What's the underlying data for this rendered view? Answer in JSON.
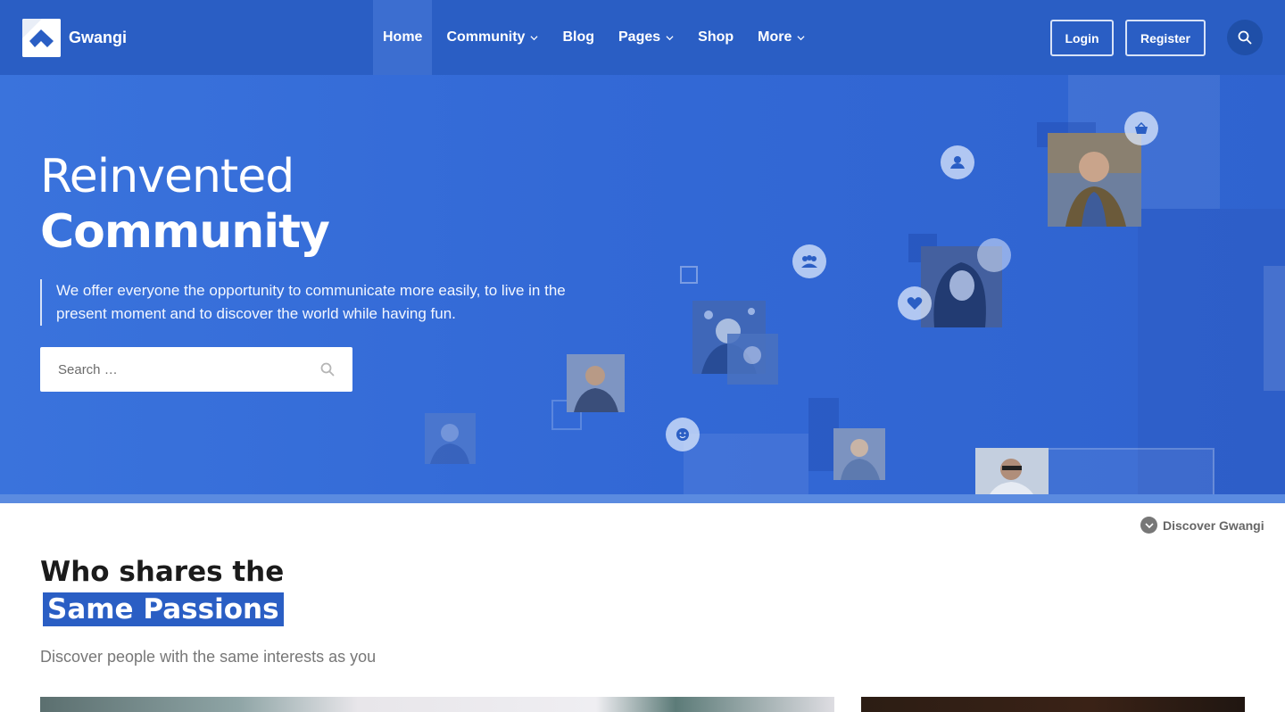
{
  "brand": {
    "name": "Gwangi"
  },
  "nav": {
    "items": [
      {
        "label": "Home",
        "active": true,
        "has_dropdown": false
      },
      {
        "label": "Community",
        "active": false,
        "has_dropdown": true
      },
      {
        "label": "Blog",
        "active": false,
        "has_dropdown": false
      },
      {
        "label": "Pages",
        "active": false,
        "has_dropdown": true
      },
      {
        "label": "Shop",
        "active": false,
        "has_dropdown": false
      },
      {
        "label": "More",
        "active": false,
        "has_dropdown": true
      }
    ],
    "login_label": "Login",
    "register_label": "Register",
    "search_icon": "search-icon"
  },
  "hero": {
    "title_line1": "Reinvented",
    "title_line2": "Community",
    "description": "We offer everyone the opportunity to communicate more easily, to live in the present moment and to discover the world while having fun.",
    "search_placeholder": "Search …",
    "bubbles": [
      "shopping-basket-icon",
      "user-handshake-icon",
      "group-icon",
      "heart-icon",
      "smile-icon",
      "user-icon"
    ]
  },
  "discover": {
    "label": "Discover Gwangi"
  },
  "section": {
    "title": "Who shares the",
    "highlight": "Same Passions",
    "subtitle": "Discover people with the same interests as you"
  },
  "colors": {
    "primary": "#2a5ec4",
    "hero_bg": "#3369d6",
    "active_nav": "#3c6ed0",
    "search_circle": "#1f4fa8"
  }
}
